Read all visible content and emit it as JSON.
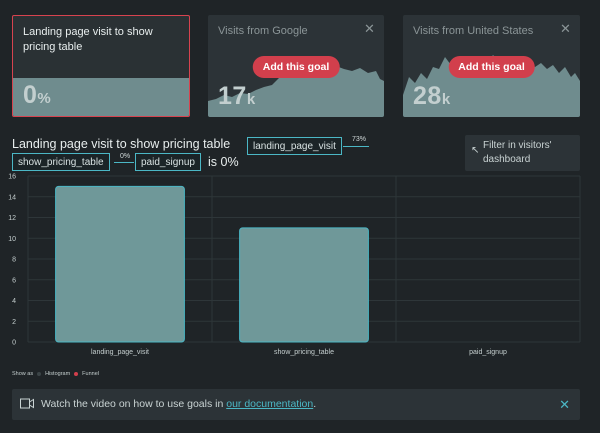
{
  "cards": [
    {
      "title": "Landing page visit to show pricing table",
      "value": "0",
      "unit": "%",
      "selected": true
    },
    {
      "title": "Visits from Google",
      "value": "17",
      "unit": "k",
      "button": "Add this goal"
    },
    {
      "title": "Visits from United States",
      "value": "28",
      "unit": "k",
      "button": "Add this goal"
    }
  ],
  "header": {
    "title": "Landing page visit to show pricing table",
    "steps": [
      {
        "label": "landing_page_visit",
        "pct": "73%"
      },
      {
        "label": "show_pricing_table",
        "pct": "0%"
      },
      {
        "label": "paid_signup"
      }
    ],
    "result": "is 0%",
    "filter": {
      "line1": "Filter in visitors'",
      "line2": "dashboard",
      "icon": "arrow-up-left-icon"
    }
  },
  "chart_data": {
    "type": "bar",
    "categories": [
      "landing_page_visit",
      "show_pricing_table",
      "paid_signup"
    ],
    "values": [
      15,
      11,
      0
    ],
    "ylim": [
      0,
      16
    ],
    "yticks": [
      0,
      2,
      4,
      6,
      8,
      10,
      12,
      14,
      16
    ],
    "grid": true
  },
  "legend": {
    "label": "Show as",
    "options": [
      "Histogram",
      "Funnel"
    ],
    "colors": [
      "#3b4447",
      "#d23f4c"
    ]
  },
  "footer": {
    "text": "Watch the video on how to use goals in",
    "link": "our documentation",
    "end": ".",
    "icon": "video-camera-icon"
  },
  "colors": {
    "accent": "#4bb7c5",
    "danger": "#d23f4c",
    "bar": "#6f9899"
  }
}
